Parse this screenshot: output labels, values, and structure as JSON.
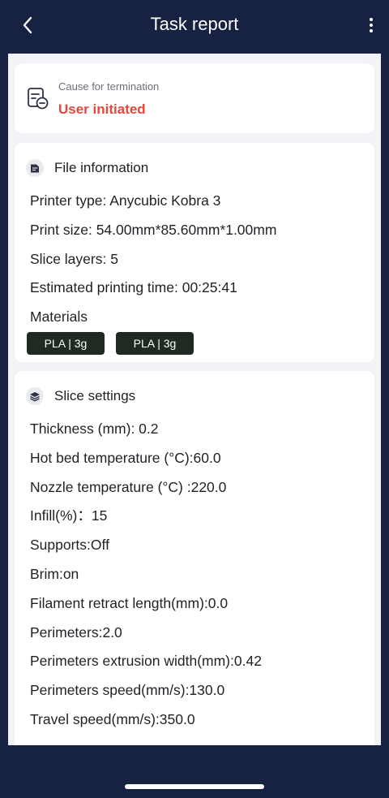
{
  "header": {
    "title": "Task report"
  },
  "termination": {
    "label": "Cause for termination",
    "value": "User initiated",
    "icon": "document-minus-icon"
  },
  "file_info": {
    "title": "File information",
    "icon": "document-icon",
    "rows": [
      "Printer type: Anycubic Kobra 3",
      "Print size: 54.00mm*85.60mm*1.00mm",
      "Slice layers: 5",
      "Estimated printing time: 00:25:41",
      "Materials"
    ],
    "materials": [
      "PLA | 3g",
      "PLA | 3g"
    ]
  },
  "slice_settings": {
    "title": "Slice settings",
    "icon": "layers-icon",
    "rows": [
      "Thickness (mm): 0.2",
      "Hot bed temperature (°C):60.0",
      "Nozzle temperature (°C) :220.0",
      "Infill(%)：15",
      "Supports:Off",
      "Brim:on",
      "Filament retract length(mm):0.0",
      "Perimeters:2.0",
      "Perimeters extrusion width(mm):0.42",
      "Perimeters speed(mm/s):130.0",
      "Travel speed(mm/s):350.0"
    ]
  },
  "colors": {
    "header_bg": "#172142",
    "accent_red": "#e8453c",
    "chip_bg": "#1f2a22"
  }
}
